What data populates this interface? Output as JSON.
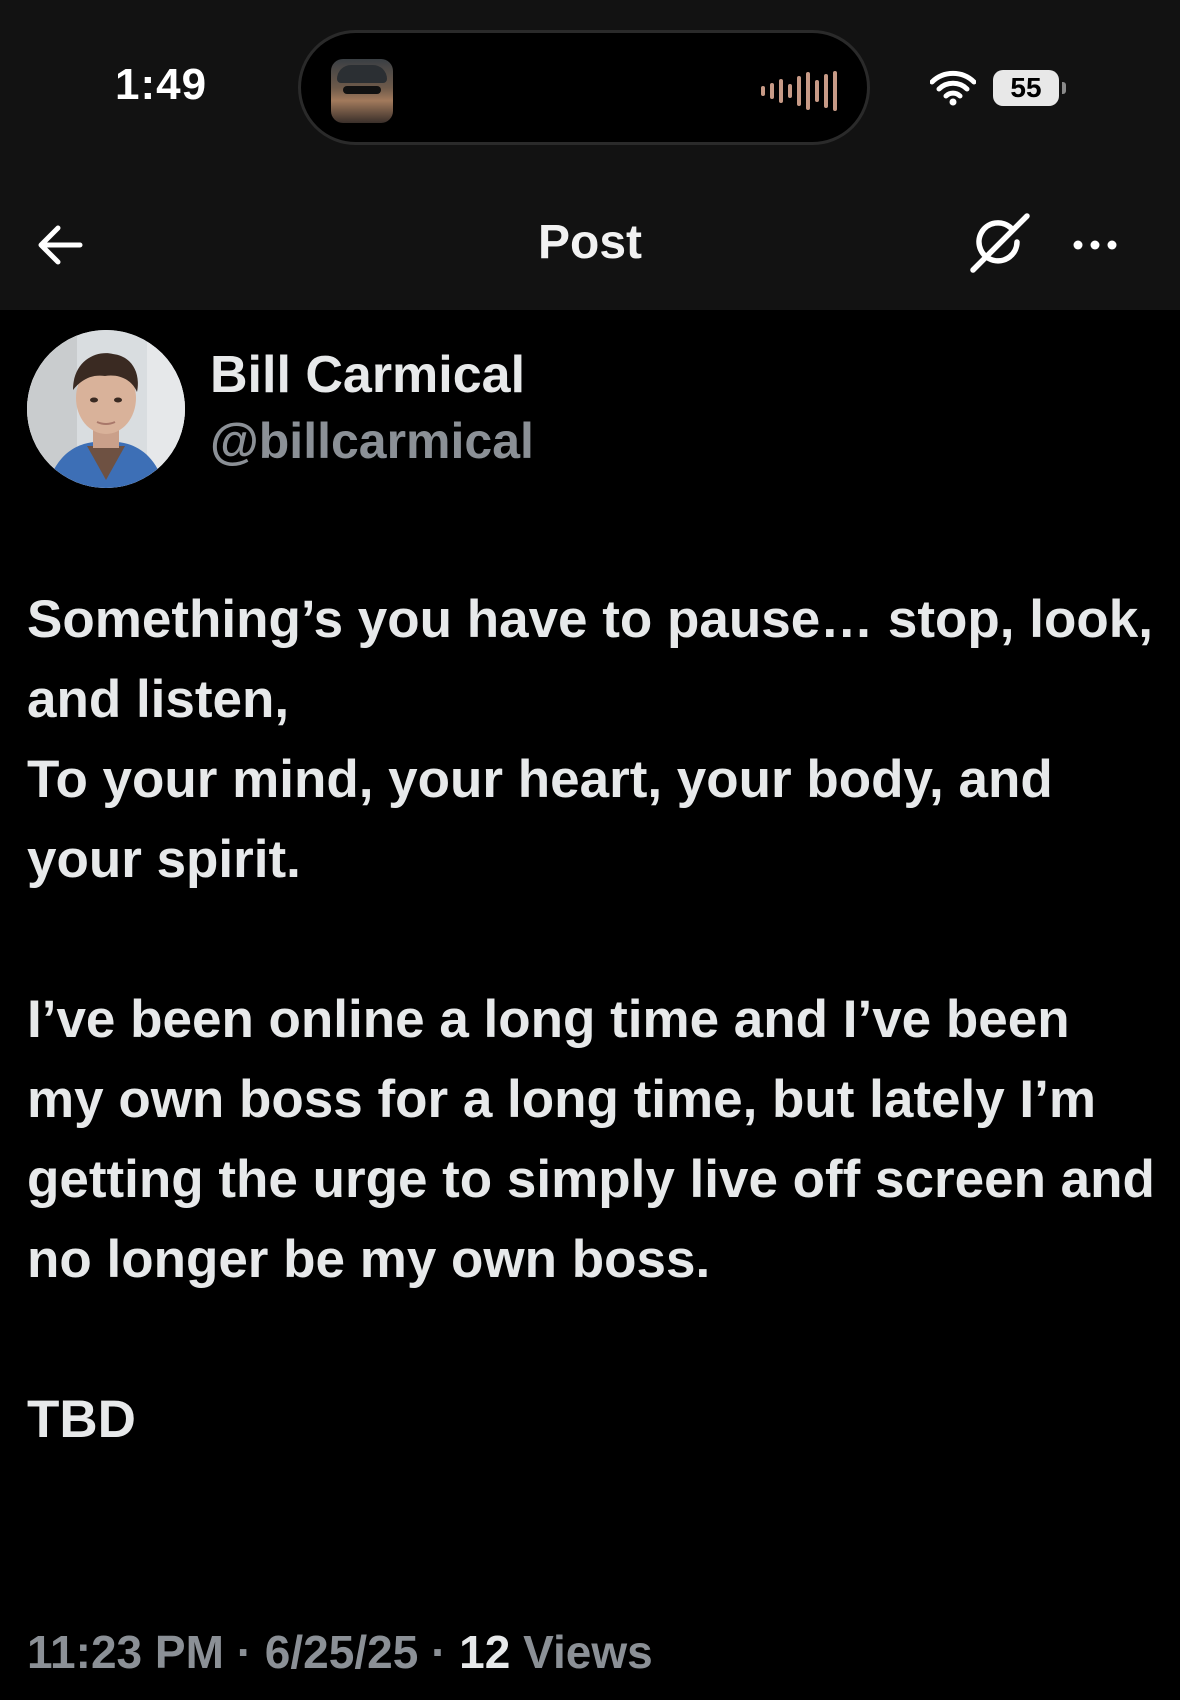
{
  "status_bar": {
    "time": "1:49",
    "battery": "55",
    "icons": [
      "now-playing-avatar",
      "audio-waveform-icon",
      "wifi-icon",
      "battery-icon"
    ],
    "waveform_color": "#c79a86"
  },
  "nav": {
    "title": "Post",
    "back_icon": "back-arrow-icon",
    "grok_icon": "grok-icon",
    "more_icon": "more-icon"
  },
  "post": {
    "author": {
      "name": "Bill Carmical",
      "handle": "@billcarmical"
    },
    "paragraphs": [
      "Something’s you have to pause… stop, look, and listen,",
      "To your mind, your heart, your body, and your spirit.",
      "I’ve been online a long time and I’ve been my own boss for a long time, but lately I’m getting the urge to simply live off screen and no longer be my own boss.",
      "TBD"
    ],
    "meta": {
      "time": "11:23 PM",
      "date": "6/25/25",
      "separator": "·",
      "views_count": "12",
      "views_label": "Views"
    }
  },
  "colors": {
    "background": "#000000",
    "header_background": "#121212",
    "text_primary": "#e7e9ea",
    "text_secondary": "#8b9096"
  }
}
